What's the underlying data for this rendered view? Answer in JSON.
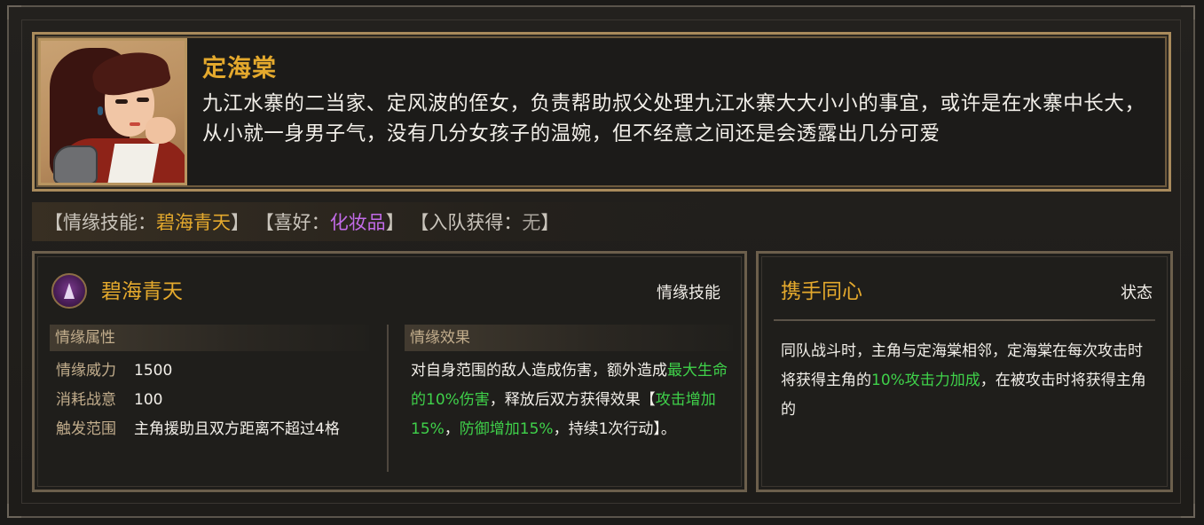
{
  "character": {
    "name": "定海棠",
    "description": "九江水寨的二当家、定风波的侄女，负责帮助叔父处理九江水寨大大小小的事宜，或许是在水寨中长大，从小就一身男子气，没有几分女孩子的温婉，但不经意之间还是会透露出几分可爱",
    "portrait_icon": "character-portrait"
  },
  "tags": {
    "bond_skill_label": "【情缘技能：",
    "bond_skill_value": "碧海青天",
    "bond_skill_close": "】",
    "hobby_label": "【喜好：",
    "hobby_value": "化妆品",
    "hobby_close": "】",
    "join_label": "【入队获得：",
    "join_value": "无",
    "join_close": "】"
  },
  "skill": {
    "icon": "purple-crystal-icon",
    "name": "碧海青天",
    "type": "情缘技能",
    "attr_header": "情缘属性",
    "effect_header": "情缘效果",
    "attributes": [
      {
        "key": "情缘威力",
        "value": "1500"
      },
      {
        "key": "消耗战意",
        "value": "100"
      },
      {
        "key": "触发范围",
        "value": "主角援助且双方距离不超过4格"
      }
    ],
    "effect": {
      "p1": "对自身范围的敌人造成伤害，额外造成",
      "g1": "最大生命的10%伤害",
      "p2": "，释放后双方获得效果【",
      "g2": "攻击增加15%",
      "p3": "，",
      "g3": "防御增加15%",
      "p4": "，持续1次行动】。"
    }
  },
  "status": {
    "name": "携手同心",
    "type": "状态",
    "text": {
      "p1": "同队战斗时，主角与定海棠相邻，定海棠在每次攻击时将获得主角的",
      "g1": "10%攻击力加成",
      "p2": "，在被攻击时将获得主角的"
    }
  },
  "colors": {
    "gold": "#e4a92d",
    "purple": "#c26be8",
    "green": "#3fd14a",
    "label": "#c2ad8c",
    "text": "#f2efe9"
  }
}
